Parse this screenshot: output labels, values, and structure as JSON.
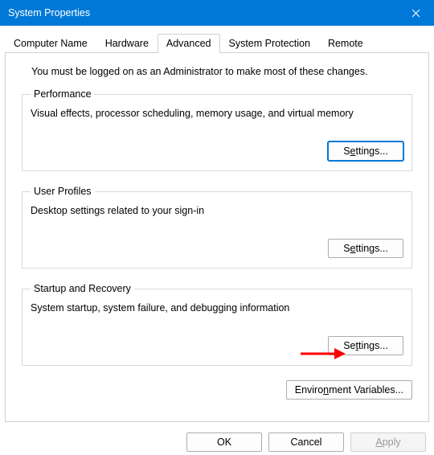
{
  "titlebar": {
    "title": "System Properties"
  },
  "tabs": {
    "computer_name": "Computer Name",
    "hardware": "Hardware",
    "advanced": "Advanced",
    "system_protection": "System Protection",
    "remote": "Remote"
  },
  "intro": "You must be logged on as an Administrator to make most of these changes.",
  "groups": {
    "performance": {
      "legend": "Performance",
      "desc": "Visual effects, processor scheduling, memory usage, and virtual memory",
      "button_pre": "S",
      "button_u": "e",
      "button_post": "ttings..."
    },
    "user_profiles": {
      "legend": "User Profiles",
      "desc": "Desktop settings related to your sign-in",
      "button_pre": "S",
      "button_u": "e",
      "button_post": "ttings..."
    },
    "startup": {
      "legend": "Startup and Recovery",
      "desc": "System startup, system failure, and debugging information",
      "button_pre": "Se",
      "button_u": "t",
      "button_post": "tings..."
    }
  },
  "env_button": {
    "pre": "Enviro",
    "u": "n",
    "post": "ment Variables..."
  },
  "footer": {
    "ok": "OK",
    "cancel": "Cancel",
    "apply_u": "A",
    "apply_post": "pply"
  }
}
